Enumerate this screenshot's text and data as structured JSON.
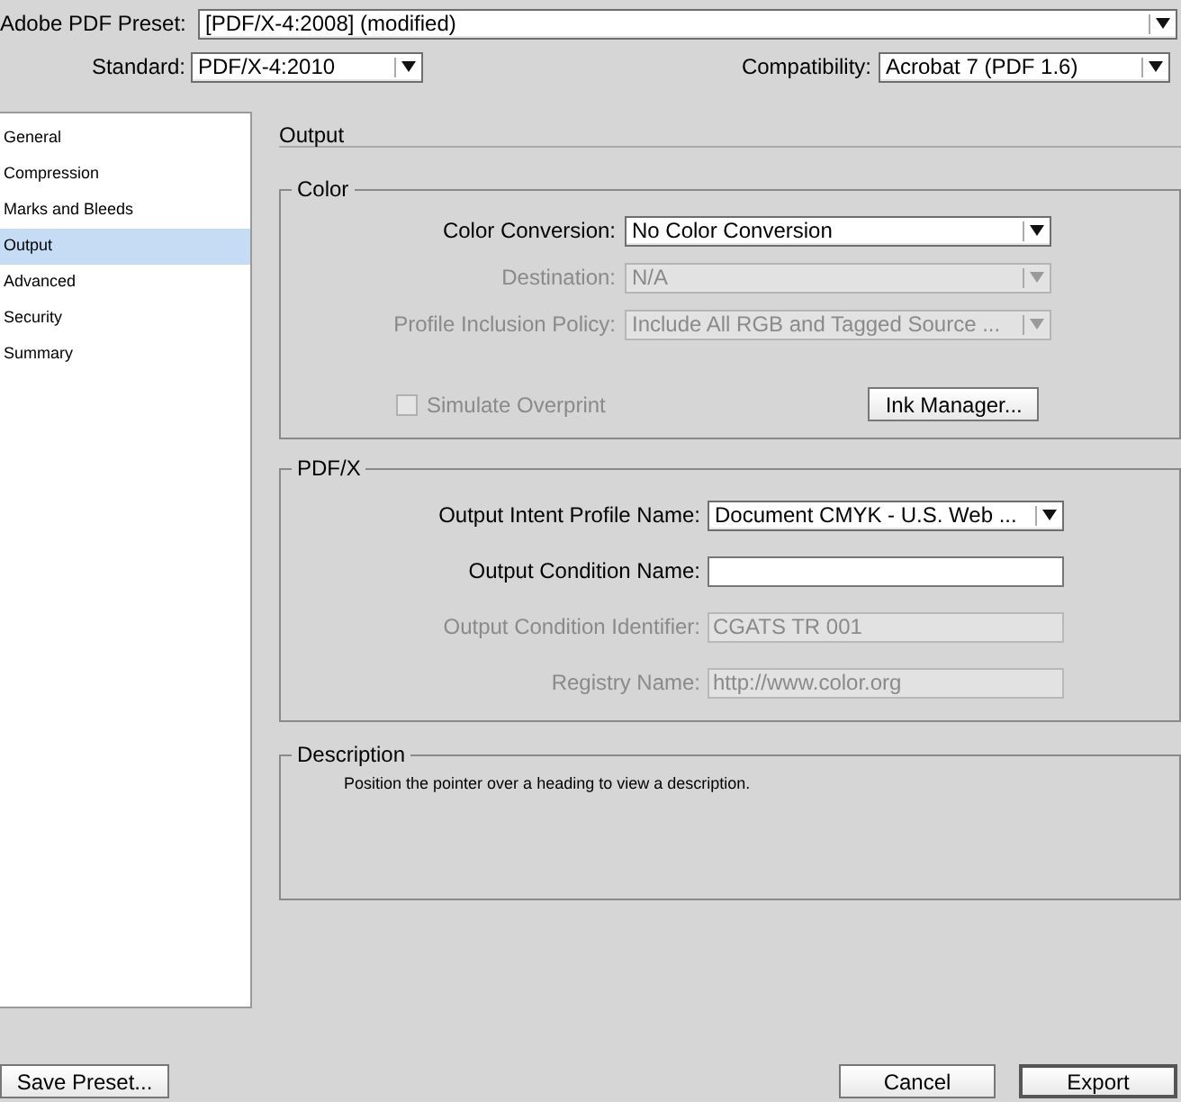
{
  "preset": {
    "label": "Adobe PDF Preset:",
    "value": "[PDF/X-4:2008] (modified)"
  },
  "standard": {
    "label": "Standard:",
    "value": "PDF/X-4:2010"
  },
  "compatibility": {
    "label": "Compatibility:",
    "value": "Acrobat 7 (PDF 1.6)"
  },
  "sidebar": {
    "items": [
      {
        "label": "General",
        "selected": false
      },
      {
        "label": "Compression",
        "selected": false
      },
      {
        "label": "Marks and Bleeds",
        "selected": false
      },
      {
        "label": "Output",
        "selected": true
      },
      {
        "label": "Advanced",
        "selected": false
      },
      {
        "label": "Security",
        "selected": false
      },
      {
        "label": "Summary",
        "selected": false
      }
    ]
  },
  "section_title": "Output",
  "color_group": {
    "title": "Color",
    "rows": [
      {
        "label": "Color Conversion:",
        "value": "No Color Conversion",
        "disabled": false
      },
      {
        "label": "Destination:",
        "value": "N/A",
        "disabled": true
      },
      {
        "label": "Profile Inclusion Policy:",
        "value": "Include All RGB and Tagged Source ...",
        "disabled": true
      }
    ],
    "checkbox": {
      "label": "Simulate Overprint",
      "checked": false,
      "disabled": true
    },
    "button": "Ink Manager..."
  },
  "pdfx_group": {
    "title": "PDF/X",
    "rows": [
      {
        "kind": "select",
        "label": "Output Intent Profile Name:",
        "value": "Document CMYK - U.S. Web ...",
        "disabled": false
      },
      {
        "kind": "input",
        "label": "Output Condition Name:",
        "value": "",
        "disabled": false
      },
      {
        "kind": "input",
        "label": "Output Condition Identifier:",
        "value": "CGATS TR 001",
        "disabled": true
      },
      {
        "kind": "input",
        "label": "Registry Name:",
        "value": "http://www.color.org",
        "disabled": true
      }
    ]
  },
  "description": {
    "title": "Description",
    "text": "Position the pointer over a heading to view a description."
  },
  "buttons": [
    {
      "label": "Save Preset...",
      "kind": "normal"
    },
    {
      "label": "Cancel",
      "kind": "normal"
    },
    {
      "label": "Export",
      "kind": "default"
    }
  ]
}
